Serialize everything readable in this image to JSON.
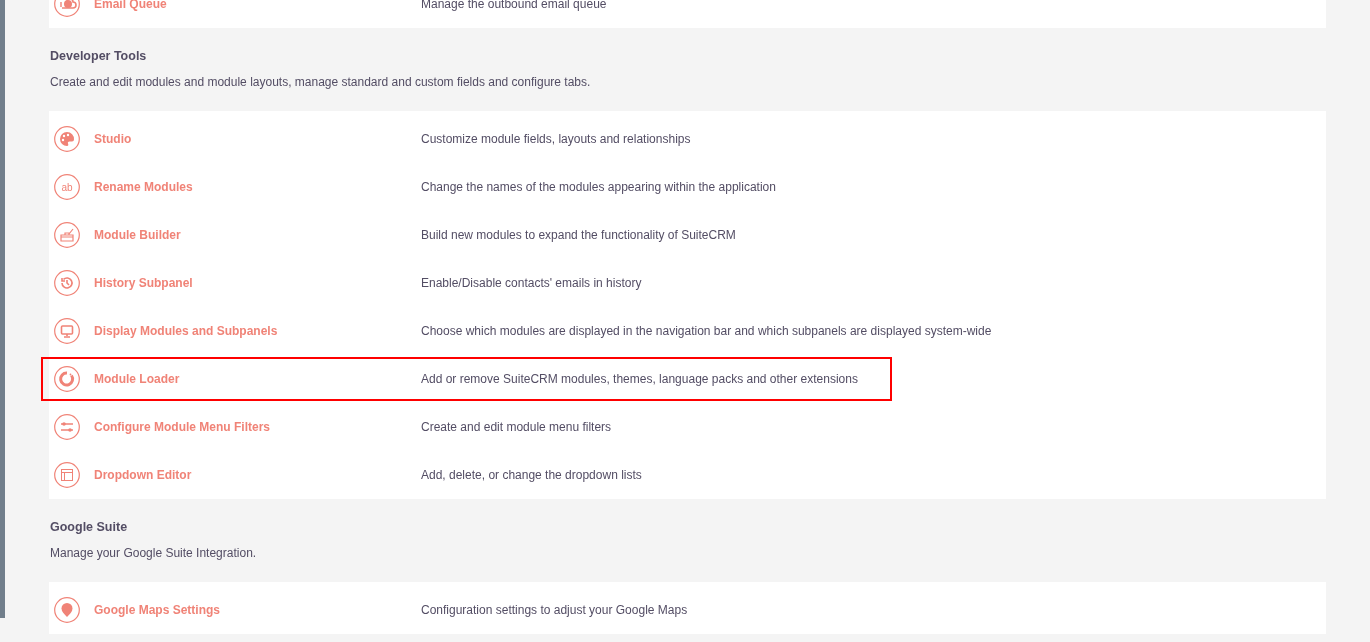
{
  "sections": [
    {
      "items": [
        {
          "label": "Email Queue",
          "description": "Manage the outbound email queue",
          "highlighted": false
        }
      ]
    },
    {
      "title": "Developer Tools",
      "description": "Create and edit modules and module layouts, manage standard and custom fields and configure tabs.",
      "items": [
        {
          "label": "Studio",
          "description": "Customize module fields, layouts and relationships",
          "highlighted": false
        },
        {
          "icon_text": "ab",
          "label": "Rename Modules",
          "description": "Change the names of the modules appearing within the application",
          "highlighted": false
        },
        {
          "label": "Module Builder",
          "description": "Build new modules to expand the functionality of SuiteCRM",
          "highlighted": false
        },
        {
          "label": "History Subpanel",
          "description": "Enable/Disable contacts' emails in history",
          "highlighted": false
        },
        {
          "label": "Display Modules and Subpanels",
          "description": "Choose which modules are displayed in the navigation bar and which subpanels are displayed system-wide",
          "highlighted": false
        },
        {
          "label": "Module Loader",
          "description": "Add or remove SuiteCRM modules, themes, language packs and other extensions",
          "highlighted": true
        },
        {
          "label": "Configure Module Menu Filters",
          "description": "Create and edit module menu filters",
          "highlighted": false
        },
        {
          "label": "Dropdown Editor",
          "description": "Add, delete, or change the dropdown lists",
          "highlighted": false
        }
      ]
    },
    {
      "title": "Google Suite",
      "description": "Manage your Google Suite Integration.",
      "items": [
        {
          "label": "Google Maps Settings",
          "description": "Configuration settings to adjust your Google Maps",
          "highlighted": false
        }
      ]
    }
  ]
}
